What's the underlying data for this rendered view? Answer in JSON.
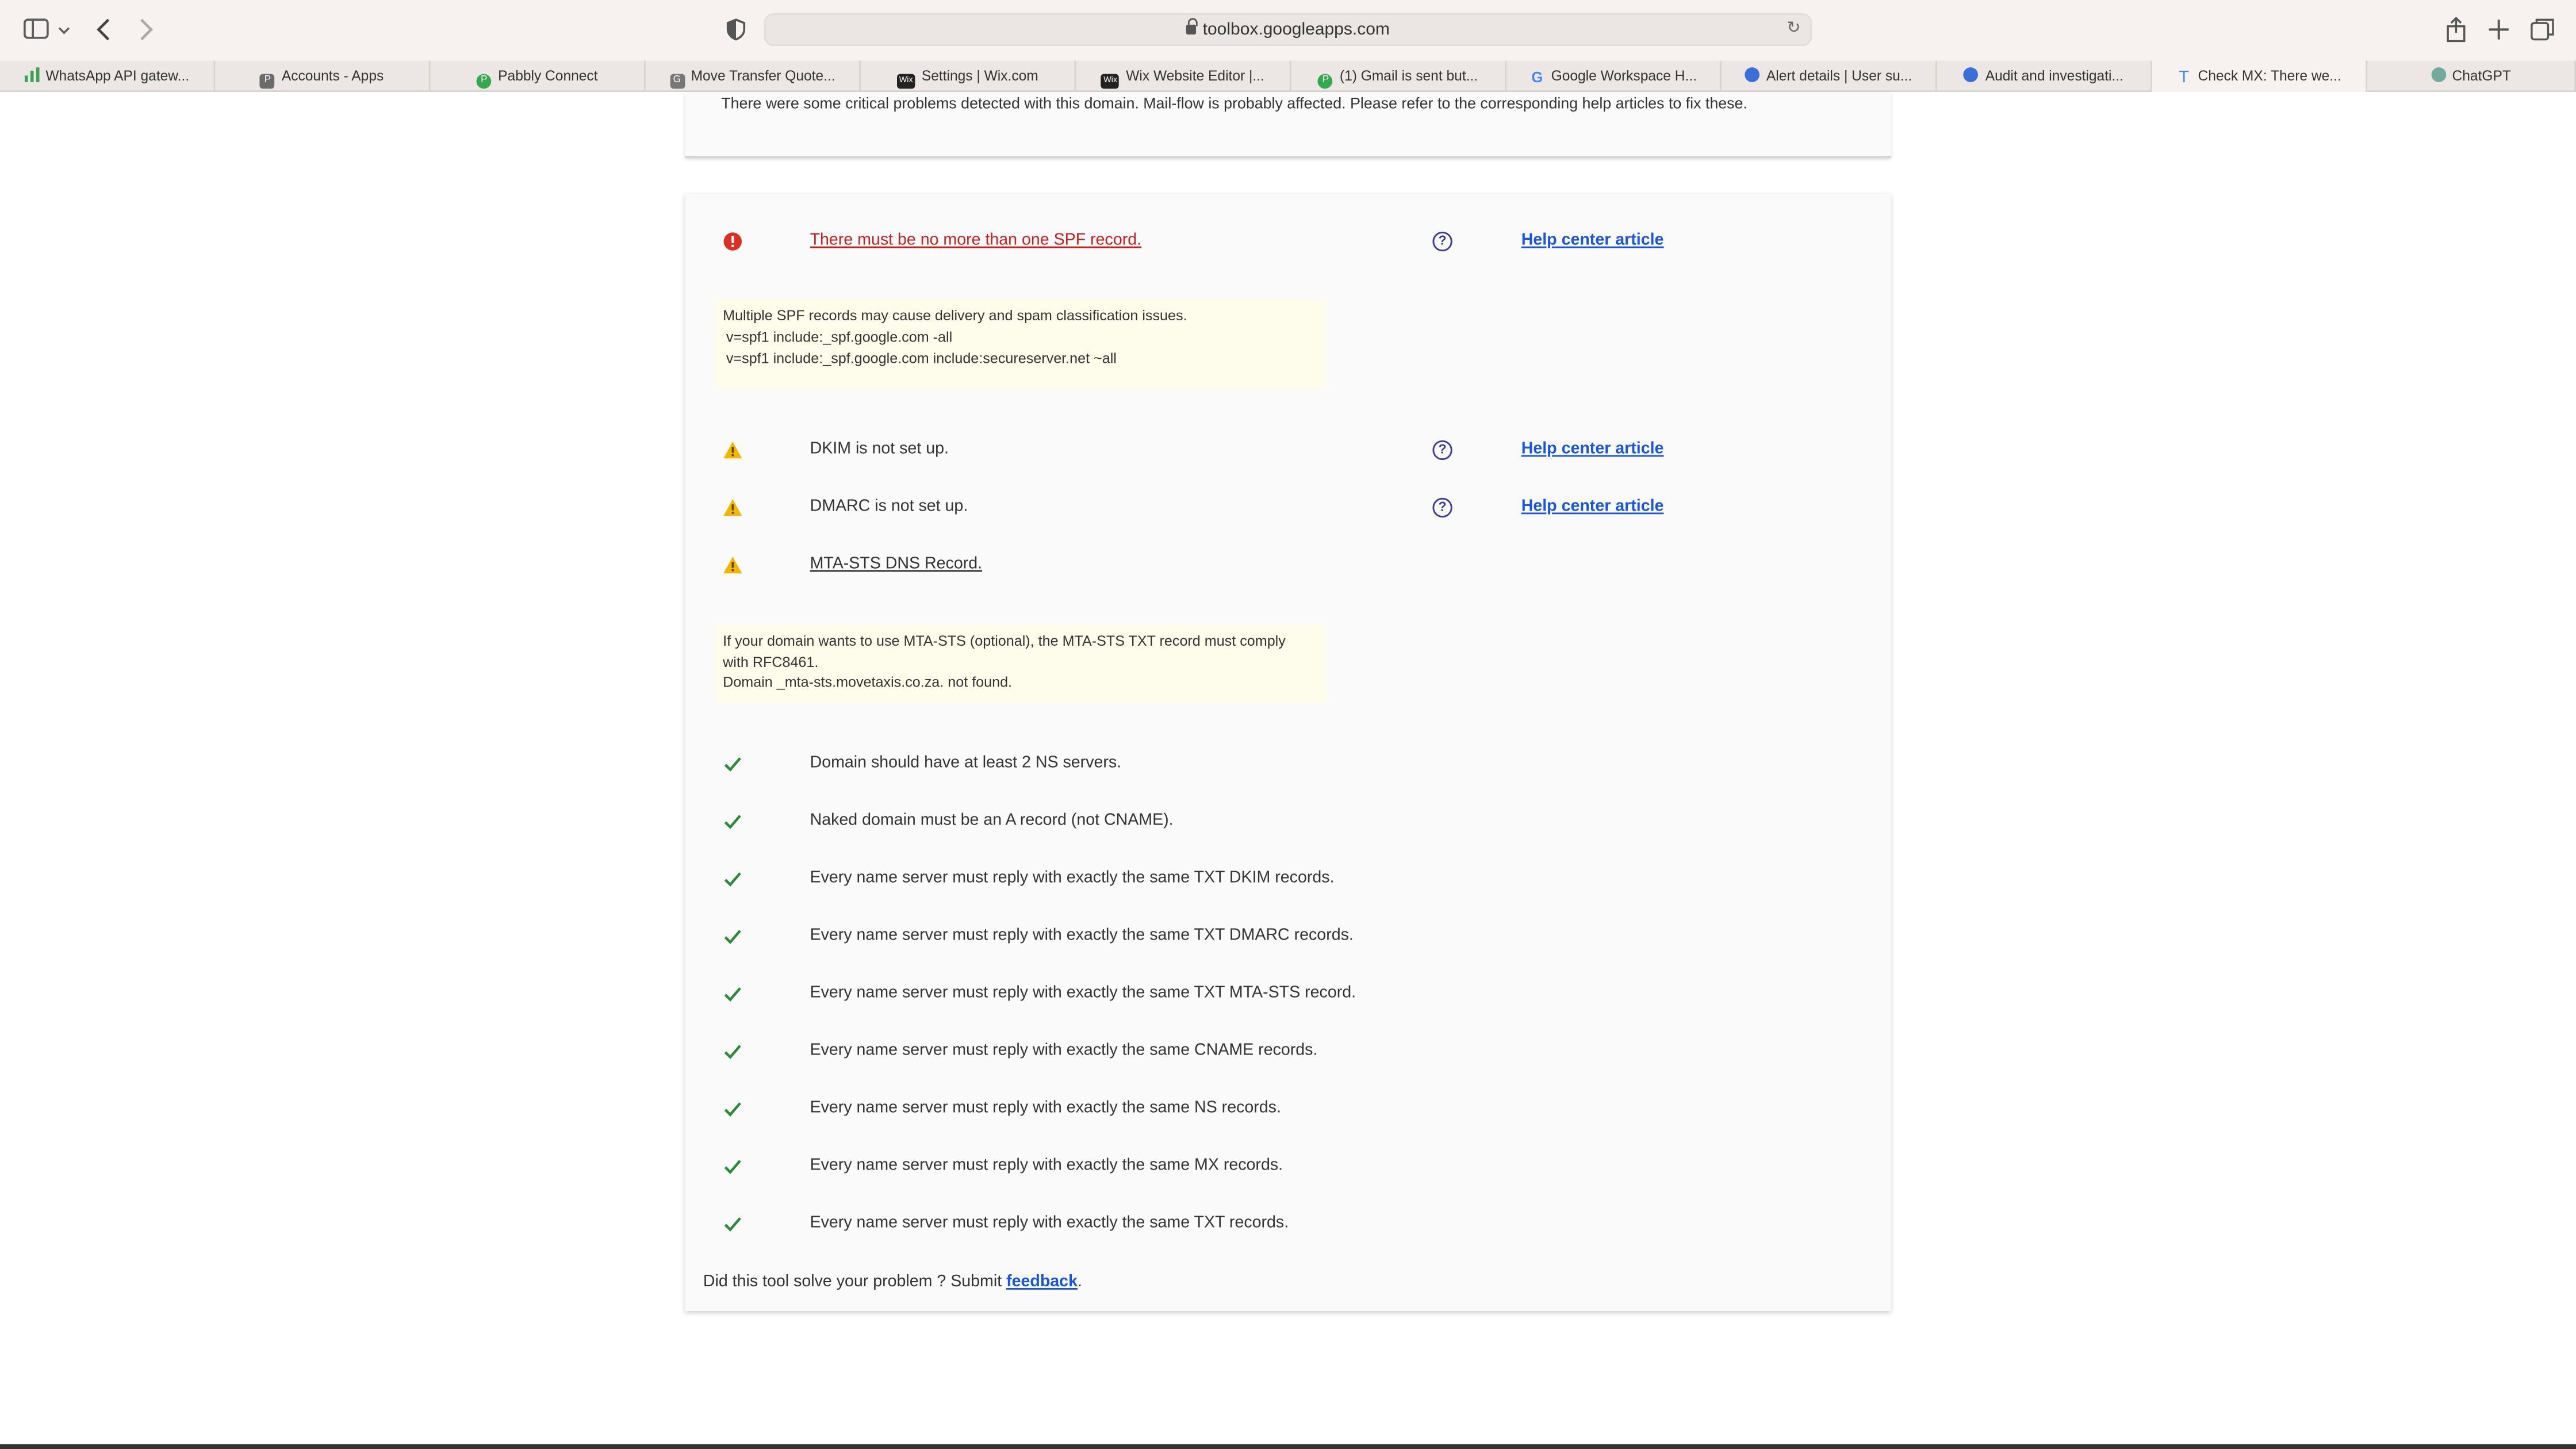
{
  "browser": {
    "url": "toolbox.googleapps.com",
    "tabs": [
      {
        "label": "WhatsApp API gatew...",
        "fav_color": "#3aa357",
        "fav_glyph": "bars"
      },
      {
        "label": "Accounts - Apps",
        "fav_color": "#6b6b6b",
        "fav_glyph": "P"
      },
      {
        "label": "Pabbly Connect",
        "fav_color": "#36a852",
        "fav_glyph": "P"
      },
      {
        "label": "Move Transfer Quote...",
        "fav_color": "#777777",
        "fav_glyph": "G"
      },
      {
        "label": "Settings | Wix.com",
        "fav_color": "#222222",
        "fav_glyph": "Wix"
      },
      {
        "label": "Wix Website Editor |...",
        "fav_color": "#222222",
        "fav_glyph": "Wix"
      },
      {
        "label": "(1) Gmail is sent but...",
        "fav_color": "#36a852",
        "fav_glyph": "P"
      },
      {
        "label": "Google Workspace H...",
        "fav_color": "#4285f4",
        "fav_glyph": "G"
      },
      {
        "label": "Alert details | User su...",
        "fav_color": "#3b6fd8",
        "fav_glyph": "shield"
      },
      {
        "label": "Audit and investigati...",
        "fav_color": "#3b6fd8",
        "fav_glyph": "shield"
      },
      {
        "label": "Check MX: There we...",
        "fav_color": "#4285f4",
        "fav_glyph": "T",
        "active": true
      },
      {
        "label": "ChatGPT",
        "fav_color": "#74aa9c",
        "fav_glyph": "gpt"
      }
    ]
  },
  "summary": {
    "text": "There were some critical problems detected with this domain. Mail-flow is probably affected. Please refer to the corresponding help articles to fix these."
  },
  "issues": {
    "spf": {
      "title": "There must be no more than one SPF record.",
      "help": "Help center article",
      "note_lines": [
        "Multiple SPF records may cause delivery and spam classification issues.",
        "v=spf1 include:_spf.google.com -all",
        "v=spf1 include:_spf.google.com include:secureserver.net ~all"
      ]
    },
    "dkim": {
      "title": "DKIM is not set up.",
      "help": "Help center article"
    },
    "dmarc": {
      "title": "DMARC is not set up.",
      "help": "Help center article"
    },
    "mtasts": {
      "title": "MTA-STS DNS Record.",
      "note_lines": [
        "If your domain wants to use MTA-STS (optional), the MTA-STS TXT record must comply",
        "with RFC8461.",
        "Domain _mta-sts.movetaxis.co.za. not found."
      ]
    }
  },
  "passed": [
    "Domain should have at least 2 NS servers.",
    "Naked domain must be an A record (not CNAME).",
    "Every name server must reply with exactly the same TXT DKIM records.",
    "Every name server must reply with exactly the same TXT DMARC records.",
    "Every name server must reply with exactly the same TXT MTA-STS record.",
    "Every name server must reply with exactly the same CNAME records.",
    "Every name server must reply with exactly the same NS records.",
    "Every name server must reply with exactly the same MX records.",
    "Every name server must reply with exactly the same TXT records."
  ],
  "footer": {
    "question": "Did this tool solve your problem ? Submit ",
    "link": "feedback",
    "period": "."
  },
  "colors": {
    "error": "#d93025",
    "warning": "#f2b600",
    "ok": "#2e8a3a",
    "link": "#1a56db"
  }
}
